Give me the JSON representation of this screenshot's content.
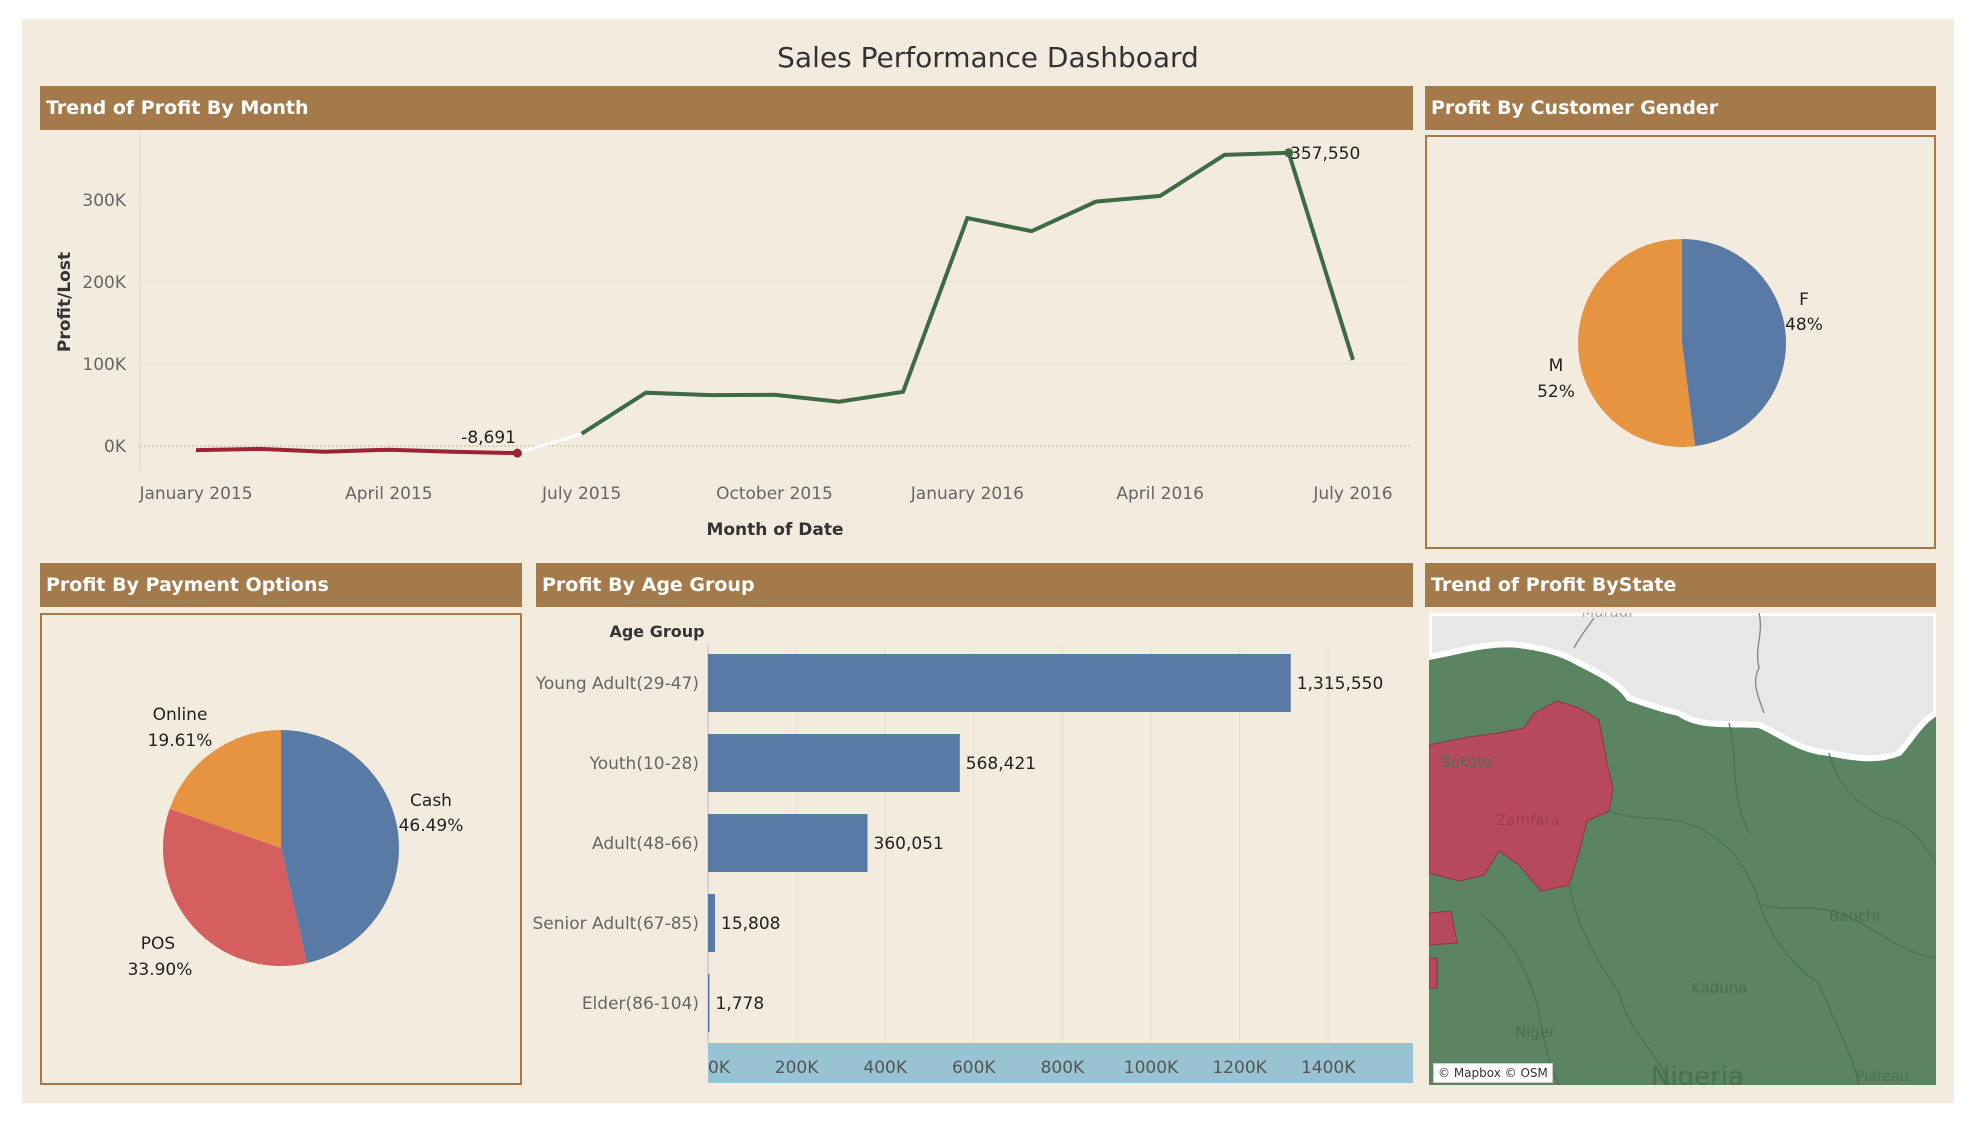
{
  "title": "Sales Performance Dashboard",
  "colors": {
    "background": "#f3ebde",
    "header": "#a47a4a",
    "positive": "#3d6b45",
    "negative": "#9b2335",
    "blue": "#5a7aa6",
    "orange": "#e69440",
    "red": "#d45f5e",
    "map_green": "#5b8462",
    "map_red": "#b84a5e",
    "axis_band": "#97c3d2"
  },
  "panels": {
    "trend": "Trend of Profit By Month",
    "gender": "Profit By Customer Gender",
    "payment": "Profit By Payment Options",
    "age": "Profit By Age Group",
    "state": "Trend of Profit ByState"
  },
  "trend_axes": {
    "ylabel": "Profit/Lost",
    "xlabel": "Month of Date",
    "yticks": [
      "0K",
      "100K",
      "200K",
      "300K"
    ],
    "xticks": [
      "January 2015",
      "April 2015",
      "July 2015",
      "October 2015",
      "January 2016",
      "April 2016",
      "July 2016"
    ]
  },
  "trend_labels": {
    "min": "-8,691",
    "max": "357,550"
  },
  "gender_labels": {
    "f_name": "F",
    "f_pct": "48%",
    "m_name": "M",
    "m_pct": "52%"
  },
  "payment_labels": {
    "online_name": "Online",
    "online_pct": "19.61%",
    "cash_name": "Cash",
    "cash_pct": "46.49%",
    "pos_name": "POS",
    "pos_pct": "33.90%"
  },
  "age_axes": {
    "header": "Age Group",
    "ticks": [
      "0K",
      "200K",
      "400K",
      "600K",
      "800K",
      "1000K",
      "1200K",
      "1400K"
    ],
    "categories": [
      "Young Adult(29-47)",
      "Youth(10-28)",
      "Adult(48-66)",
      "Senior Adult(67-85)",
      "Elder(86-104)"
    ],
    "value_labels": [
      "1,315,550",
      "568,421",
      "360,051",
      "15,808",
      "1,778"
    ]
  },
  "map_labels": {
    "maradi": "Maradi",
    "sokoto": "Sokoto",
    "zamfara": "Zamfara",
    "bauchi": "Bauchi",
    "kaduna": "Kaduna",
    "niger": "Niger",
    "nigeria": "Nigeria",
    "plateau": "Plateau",
    "credit": "© Mapbox © OSM"
  },
  "chart_data": [
    {
      "type": "line",
      "title": "Trend of Profit By Month",
      "xlabel": "Month of Date",
      "ylabel": "Profit/Lost",
      "x": [
        "2015-01",
        "2015-02",
        "2015-03",
        "2015-04",
        "2015-05",
        "2015-06",
        "2015-07",
        "2015-08",
        "2015-09",
        "2015-10",
        "2015-11",
        "2015-12",
        "2016-01",
        "2016-02",
        "2016-03",
        "2016-04",
        "2016-05",
        "2016-06",
        "2016-07"
      ],
      "values": [
        -5000,
        -3500,
        -7000,
        -4500,
        -7000,
        -8691,
        15000,
        65000,
        62000,
        62500,
        54000,
        66000,
        278000,
        262000,
        298000,
        305000,
        355000,
        357550,
        105000
      ],
      "ylim": [
        -25000,
        375000
      ],
      "grid": true
    },
    {
      "type": "pie",
      "title": "Profit By Customer Gender",
      "categories": [
        "F",
        "M"
      ],
      "values": [
        48,
        52
      ]
    },
    {
      "type": "pie",
      "title": "Profit By Payment Options",
      "categories": [
        "Cash",
        "POS",
        "Online"
      ],
      "values": [
        46.49,
        33.9,
        19.61
      ]
    },
    {
      "type": "bar",
      "title": "Profit By Age Group",
      "categories": [
        "Young Adult(29-47)",
        "Youth(10-28)",
        "Adult(48-66)",
        "Senior Adult(67-85)",
        "Elder(86-104)"
      ],
      "values": [
        1315550,
        568421,
        360051,
        15808,
        1778
      ],
      "ylim": [
        0,
        1600000
      ]
    }
  ]
}
